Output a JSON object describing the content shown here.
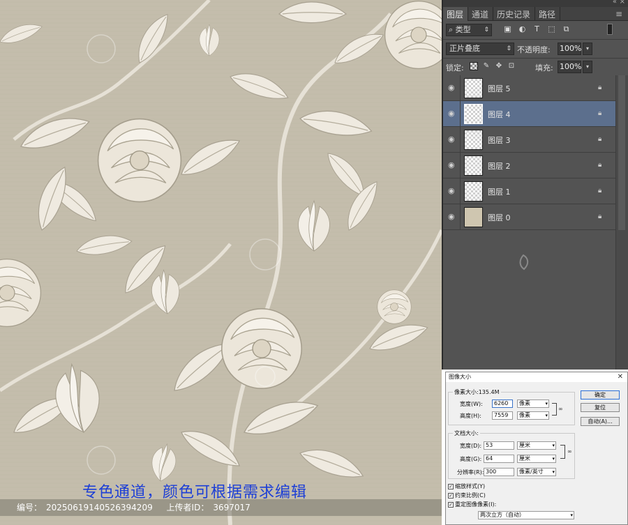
{
  "artwork": {
    "caption": "专色通道，颜色可根据需求编辑",
    "footer": {
      "id_label": "编号：",
      "id_value": "20250619140526394209",
      "uploader_label": "上传者ID：",
      "uploader_value": "3697017"
    },
    "colors": {
      "background": "#c4bdac",
      "flower": "#f2eee6",
      "caption": "#1d3fd6"
    }
  },
  "layers_panel": {
    "tabs": [
      {
        "label": "图层",
        "active": true
      },
      {
        "label": "通道",
        "active": false
      },
      {
        "label": "历史记录",
        "active": false
      },
      {
        "label": "路径",
        "active": false
      }
    ],
    "filter_kind": "类型",
    "blend_mode": "正片叠底",
    "opacity_label": "不透明度:",
    "opacity_value": "100%",
    "lock_label": "锁定:",
    "fill_label": "填充:",
    "fill_value": "100%",
    "layers": [
      {
        "name": "图层 5",
        "selected": false,
        "thumb": "transparent"
      },
      {
        "name": "图层 4",
        "selected": true,
        "thumb": "transparent"
      },
      {
        "name": "图层 3",
        "selected": false,
        "thumb": "transparent"
      },
      {
        "name": "图层 2",
        "selected": false,
        "thumb": "transparent"
      },
      {
        "name": "图层 1",
        "selected": false,
        "thumb": "transparent"
      },
      {
        "name": "图层 0",
        "selected": false,
        "thumb": "solid"
      }
    ],
    "colors": {
      "panel": "#535353",
      "selected_row": "#5c6f8d"
    }
  },
  "image_size_dialog": {
    "title": "图像大小",
    "pixel_dimensions": "像素大小:135.4M",
    "width_label": "宽度(W):",
    "width_value": "6260",
    "width_unit": "像素",
    "height_label": "高度(H):",
    "height_value": "7559",
    "height_unit": "像素",
    "document_size": "文档大小:",
    "doc_width_label": "宽度(D):",
    "doc_width_value": "53",
    "doc_width_unit": "厘米",
    "doc_height_label": "高度(G):",
    "doc_height_value": "64",
    "doc_height_unit": "厘米",
    "resolution_label": "分辨率(R):",
    "resolution_value": "300",
    "resolution_unit": "像素/英寸",
    "ok_button": "确定",
    "reset_button": "复位",
    "auto_button": "自动(A)...",
    "scale_styles": "缩放样式(Y)",
    "constrain_proportions": "约束比例(C)",
    "resample": "重定图像像素(I):",
    "resample_method": "两次立方（自动）"
  }
}
